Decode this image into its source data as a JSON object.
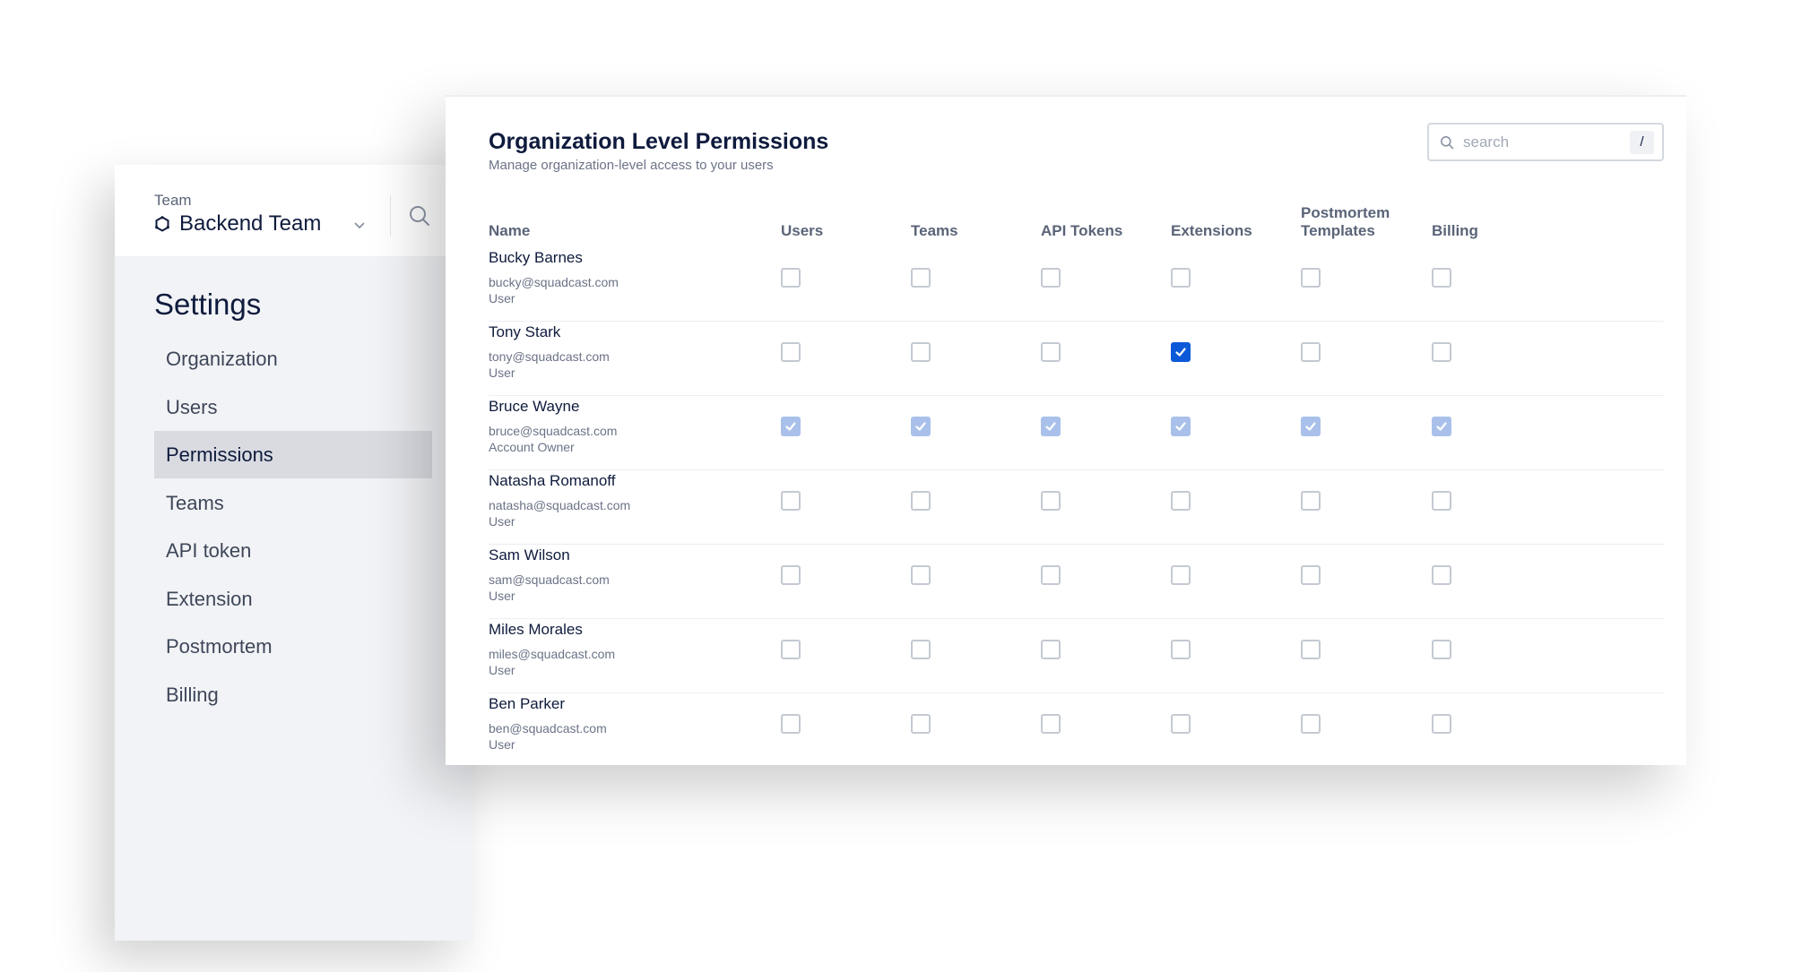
{
  "sidebar": {
    "team_label": "Team",
    "team_name": "Backend Team",
    "title": "Settings",
    "items": [
      {
        "label": "Organization",
        "active": false
      },
      {
        "label": "Users",
        "active": false
      },
      {
        "label": "Permissions",
        "active": true
      },
      {
        "label": "Teams",
        "active": false
      },
      {
        "label": "API token",
        "active": false
      },
      {
        "label": "Extension",
        "active": false
      },
      {
        "label": "Postmortem",
        "active": false
      },
      {
        "label": "Billing",
        "active": false
      }
    ]
  },
  "main": {
    "title": "Organization Level Permissions",
    "subtitle": "Manage organization-level access to your users",
    "search": {
      "placeholder": "search",
      "value": "",
      "shortcut": "/"
    },
    "columns": [
      "Name",
      "Users",
      "Teams",
      "API Tokens",
      "Extensions",
      "Postmortem Templates",
      "Billing"
    ],
    "rows": [
      {
        "name": "Bucky Barnes",
        "email": "bucky@squadcast.com",
        "role": "User",
        "permissions": [
          "unchecked",
          "unchecked",
          "unchecked",
          "unchecked",
          "unchecked",
          "unchecked"
        ]
      },
      {
        "name": "Tony Stark",
        "email": "tony@squadcast.com",
        "role": "User",
        "permissions": [
          "unchecked",
          "unchecked",
          "unchecked",
          "checked",
          "unchecked",
          "unchecked"
        ]
      },
      {
        "name": "Bruce Wayne",
        "email": "bruce@squadcast.com",
        "role": "Account Owner",
        "permissions": [
          "disabled-checked",
          "disabled-checked",
          "disabled-checked",
          "disabled-checked",
          "disabled-checked",
          "disabled-checked"
        ]
      },
      {
        "name": "Natasha Romanoff",
        "email": "natasha@squadcast.com",
        "role": "User",
        "permissions": [
          "unchecked",
          "unchecked",
          "unchecked",
          "unchecked",
          "unchecked",
          "unchecked"
        ]
      },
      {
        "name": "Sam Wilson",
        "email": "sam@squadcast.com",
        "role": "User",
        "permissions": [
          "unchecked",
          "unchecked",
          "unchecked",
          "unchecked",
          "unchecked",
          "unchecked"
        ]
      },
      {
        "name": "Miles Morales",
        "email": "miles@squadcast.com",
        "role": "User",
        "permissions": [
          "unchecked",
          "unchecked",
          "unchecked",
          "unchecked",
          "unchecked",
          "unchecked"
        ]
      },
      {
        "name": "Ben Parker",
        "email": "ben@squadcast.com",
        "role": "User",
        "permissions": [
          "unchecked",
          "unchecked",
          "unchecked",
          "unchecked",
          "unchecked",
          "unchecked"
        ]
      }
    ]
  },
  "colors": {
    "accent": "#0b59d8",
    "accent_disabled": "#a9c1ea",
    "sidebar_bg": "#f2f3f6",
    "active_nav_bg": "#d9dbe1",
    "text_primary": "#0f1b3d"
  },
  "icons": {
    "team": "team-hexagon-icon",
    "chevron": "chevron-down-icon",
    "search": "search-icon",
    "check": "check-icon"
  }
}
